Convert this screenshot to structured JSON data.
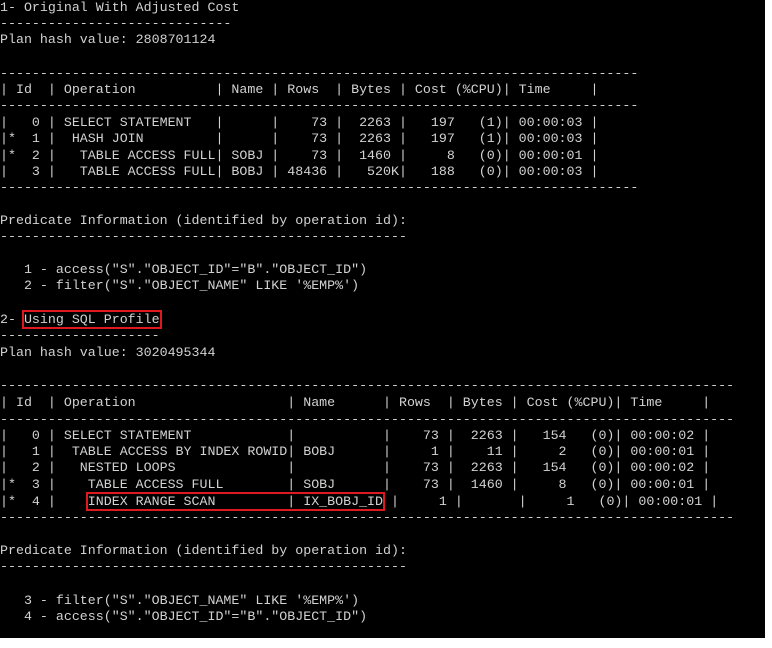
{
  "colors": {
    "background": "#000000",
    "text": "#d2d2d2",
    "highlight_box": "#e0191f"
  },
  "plan1": {
    "title": "1- Original With Adjusted Cost",
    "title_rule": "-----------------------------",
    "plan_hash": "Plan hash value: 2808701124",
    "border": "--------------------------------------------------------------------------------",
    "header": "| Id  | Operation          | Name | Rows  | Bytes | Cost (%CPU)| Time     |",
    "rows": [
      "|   0 | SELECT STATEMENT   |      |    73 |  2263 |   197   (1)| 00:00:03 |",
      "|*  1 |  HASH JOIN         |      |    73 |  2263 |   197   (1)| 00:00:03 |",
      "|*  2 |   TABLE ACCESS FULL| SOBJ |    73 |  1460 |     8   (0)| 00:00:01 |",
      "|   3 |   TABLE ACCESS FULL| BOBJ | 48436 |   520K|   188   (0)| 00:00:03 |"
    ],
    "predicate_title": "Predicate Information (identified by operation id):",
    "predicate_rule": "---------------------------------------------------",
    "predicates": [
      "   1 - access(\"S\".\"OBJECT_ID\"=\"B\".\"OBJECT_ID\")",
      "   2 - filter(\"S\".\"OBJECT_NAME\" LIKE '%EMP%')"
    ]
  },
  "plan2": {
    "title_prefix": "2- ",
    "title_highlight": "Using SQL Profile",
    "title_rule": "--------------------",
    "plan_hash": "Plan hash value: 3020495344",
    "border": "--------------------------------------------------------------------------------------------",
    "header": "| Id  | Operation                   | Name      | Rows  | Bytes | Cost (%CPU)| Time     |",
    "rows": [
      {
        "pre": "|   0 | SELECT STATEMENT            |           |    73 |  2263 |   154   (0)| 00:00:02 |"
      },
      {
        "pre": "|   1 |  TABLE ACCESS BY INDEX ROWID| BOBJ      |     1 |    11 |     2   (0)| 00:00:01 |"
      },
      {
        "pre": "|   2 |   NESTED LOOPS              |           |    73 |  2263 |   154   (0)| 00:00:02 |"
      },
      {
        "pre": "|*  3 |    TABLE ACCESS FULL        | SOBJ      |    73 |  1460 |     8   (0)| 00:00:01 |"
      },
      {
        "pre": "|*  4 |    ",
        "mark": "INDEX RANGE SCAN         | IX_BOBJ_ID",
        "post": " |     1 |       |     1   (0)| 00:00:01 |"
      }
    ],
    "predicate_title": "Predicate Information (identified by operation id):",
    "predicate_rule": "---------------------------------------------------",
    "predicates": [
      "   3 - filter(\"S\".\"OBJECT_NAME\" LIKE '%EMP%')",
      "   4 - access(\"S\".\"OBJECT_ID\"=\"B\".\"OBJECT_ID\")"
    ]
  }
}
